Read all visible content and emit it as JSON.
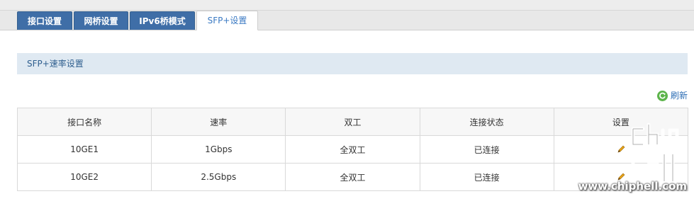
{
  "tabs": [
    {
      "label": "接口设置",
      "active": false
    },
    {
      "label": "网桥设置",
      "active": false
    },
    {
      "label": "IPv6桥模式",
      "active": false
    },
    {
      "label": "SFP+设置",
      "active": true
    }
  ],
  "section": {
    "title": "SFP+速率设置"
  },
  "toolbar": {
    "refresh_label": "刷新",
    "refresh_icon": "refresh-icon"
  },
  "table": {
    "headers": [
      "接口名称",
      "速率",
      "双工",
      "连接状态",
      "设置"
    ],
    "rows": [
      {
        "name": "10GE1",
        "speed": "1Gbps",
        "duplex": "全双工",
        "status": "已连接",
        "action_icon": "edit-icon"
      },
      {
        "name": "10GE2",
        "speed": "2.5Gbps",
        "duplex": "全双工",
        "status": "已连接",
        "action_icon": "edit-icon"
      }
    ]
  },
  "watermark": {
    "text": "www.chiphell.com"
  },
  "colors": {
    "tab_bg": "#3f6ea7",
    "tab_active_text": "#3b7ac3",
    "section_bg": "#dfe9f2",
    "refresh_green": "#5db44b",
    "link_blue": "#2d6eb5"
  }
}
